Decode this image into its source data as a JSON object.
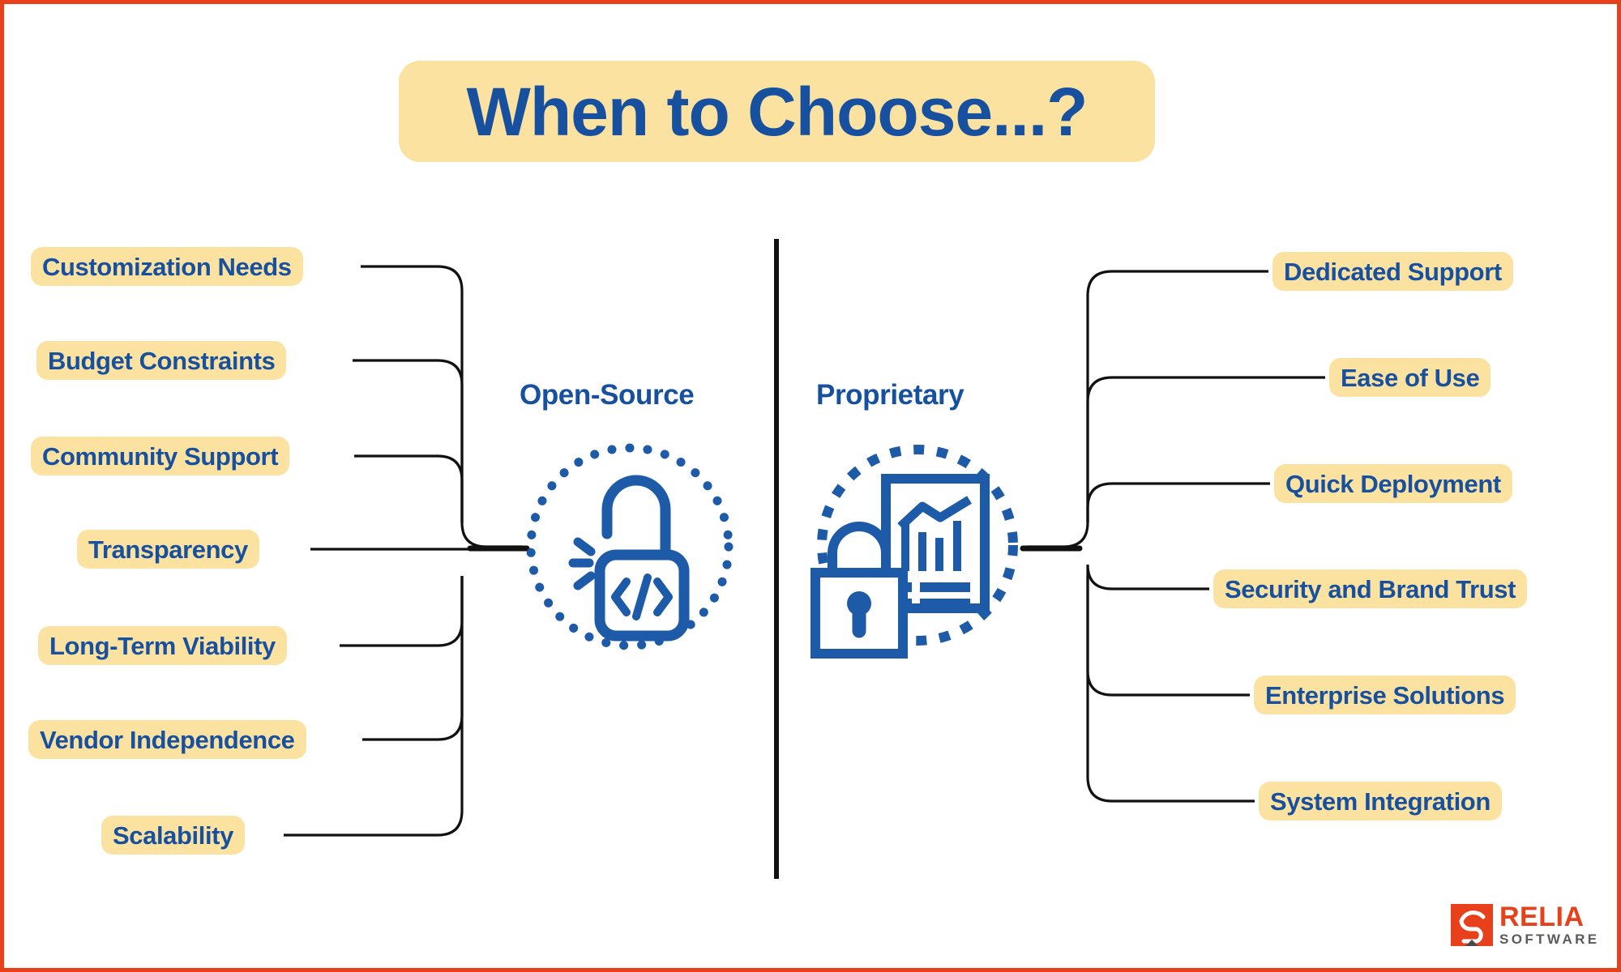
{
  "colors": {
    "pill_bg": "#FCE2A0",
    "brand_blue": "#16509F",
    "brand_orange": "#E8401A",
    "line": "#111111",
    "background": "#FFFFFF"
  },
  "header": {
    "title": "When to Choose...?"
  },
  "branches": [
    {
      "id": "open-source",
      "heading": "Open-Source",
      "icon": "open-padlock-code-icon",
      "side": "left",
      "items": [
        {
          "label": "Customization Needs"
        },
        {
          "label": "Budget Constraints"
        },
        {
          "label": "Community Support"
        },
        {
          "label": "Transparency"
        },
        {
          "label": "Long-Term Viability"
        },
        {
          "label": "Vendor Independence"
        },
        {
          "label": "Scalability"
        }
      ]
    },
    {
      "id": "proprietary",
      "heading": "Proprietary",
      "icon": "closed-padlock-report-icon",
      "side": "right",
      "items": [
        {
          "label": "Dedicated Support"
        },
        {
          "label": "Ease of Use"
        },
        {
          "label": "Quick Deployment"
        },
        {
          "label": "Security and Brand Trust"
        },
        {
          "label": "Enterprise Solutions"
        },
        {
          "label": "System Integration"
        }
      ]
    }
  ],
  "logo": {
    "mark": "relia-s-mark-icon",
    "primary": "RELIA",
    "secondary": "SOFTWARE"
  }
}
